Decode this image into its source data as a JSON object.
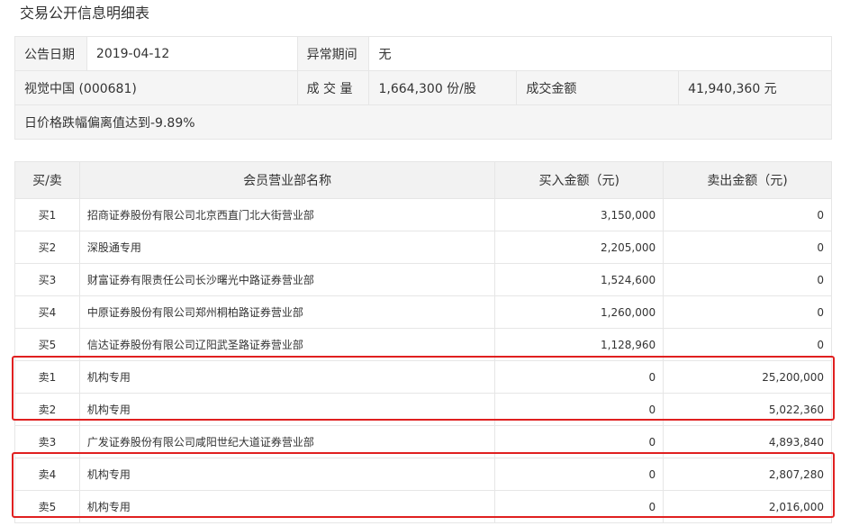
{
  "page": {
    "title": "交易公开信息明细表"
  },
  "info": {
    "date_label": "公告日期",
    "date_value": "2019-04-12",
    "abnormal_label": "异常期间",
    "abnormal_value": "无",
    "stock_name": "视觉中国 (000681)",
    "volume_label": "成 交 量",
    "volume_value": "1,664,300 份/股",
    "amount_label": "成交金额",
    "amount_value": "41,940,360 元",
    "reason": "日价格跌幅偏离值达到-9.89%"
  },
  "table": {
    "headers": [
      "买/卖",
      "会员营业部名称",
      "买入金额（元)",
      "卖出金额（元)"
    ],
    "rows": [
      {
        "dir": "买1",
        "name": "招商证券股份有限公司北京西直门北大街营业部",
        "buy": "3,150,000",
        "sell": "0"
      },
      {
        "dir": "买2",
        "name": "深股通专用",
        "buy": "2,205,000",
        "sell": "0"
      },
      {
        "dir": "买3",
        "name": "财富证券有限责任公司长沙曙光中路证券营业部",
        "buy": "1,524,600",
        "sell": "0"
      },
      {
        "dir": "买4",
        "name": "中原证券股份有限公司郑州桐柏路证券营业部",
        "buy": "1,260,000",
        "sell": "0"
      },
      {
        "dir": "买5",
        "name": "信达证券股份有限公司辽阳武圣路证券营业部",
        "buy": "1,128,960",
        "sell": "0"
      },
      {
        "dir": "卖1",
        "name": "机构专用",
        "buy": "0",
        "sell": "25,200,000"
      },
      {
        "dir": "卖2",
        "name": "机构专用",
        "buy": "0",
        "sell": "5,022,360"
      },
      {
        "dir": "卖3",
        "name": "广发证券股份有限公司咸阳世纪大道证券营业部",
        "buy": "0",
        "sell": "4,893,840"
      },
      {
        "dir": "卖4",
        "name": "机构专用",
        "buy": "0",
        "sell": "2,807,280"
      },
      {
        "dir": "卖5",
        "name": "机构专用",
        "buy": "0",
        "sell": "2,016,000"
      }
    ]
  },
  "colors": {
    "highlight": "#e02020",
    "header_bg": "#f2f2f2",
    "border": "#e6e6e6"
  }
}
